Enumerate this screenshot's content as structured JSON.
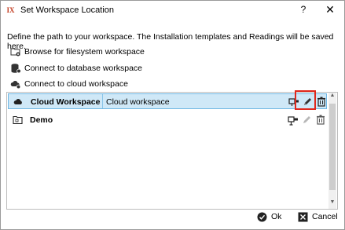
{
  "window": {
    "app_icon_text": "IX",
    "title": "Set Workspace Location",
    "help_label": "?",
    "close_label": "✕"
  },
  "description": "Define the path to your workspace. The Installation templates and Readings will be saved here.",
  "actions": [
    {
      "label": "Browse for filesystem workspace",
      "icon": "folder-gear-icon"
    },
    {
      "label": "Connect to database workspace",
      "icon": "database-icon"
    },
    {
      "label": "Connect to cloud workspace",
      "icon": "cloud-gear-icon"
    }
  ],
  "workspaces": [
    {
      "name": "Cloud Workspace",
      "description": "Cloud workspace",
      "selected": true
    },
    {
      "name": "Demo",
      "description": "",
      "selected": false
    }
  ],
  "buttons": {
    "ok_label": "Ok",
    "cancel_label": "Cancel"
  },
  "colors": {
    "selection_bg": "#cfe8f7",
    "highlight_border": "#e0271b"
  }
}
